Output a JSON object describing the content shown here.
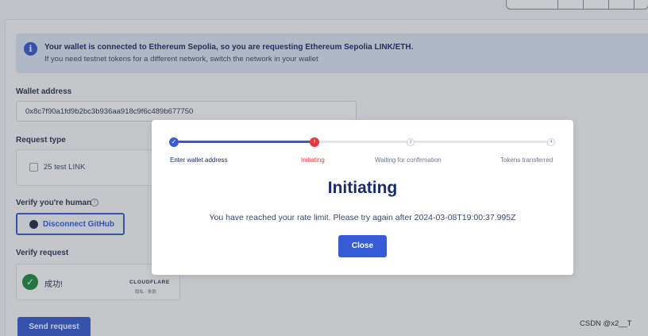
{
  "banner": {
    "title": "Your wallet is connected to Ethereum Sepolia, so you are requesting Ethereum Sepolia LINK/ETH.",
    "subtitle": "If you need testnet tokens for a different network, switch the network in your wallet"
  },
  "form": {
    "wallet_label": "Wallet address",
    "wallet_value": "0x8c7f90a1fd9b2bc3b936aa918c9f6c489b677750",
    "request_type_label": "Request type",
    "request_option": "25 test LINK",
    "verify_human_label": "Verify you're human",
    "github_button": "Disconnect GitHub",
    "verify_request_label": "Verify request",
    "captcha_status": "成功!",
    "captcha_brand": "CLOUDFLARE",
    "captcha_links": "隐私 · 条款",
    "send_button": "Send request"
  },
  "modal": {
    "steps": [
      {
        "label": "Enter wallet address",
        "status": "done"
      },
      {
        "label": "Initiating",
        "status": "error"
      },
      {
        "label": "Waiting for confirmation",
        "status": "pending"
      },
      {
        "label": "Tokens transferred",
        "status": "pending"
      }
    ],
    "step_numbers": [
      "3",
      "4"
    ],
    "title": "Initiating",
    "message": "You have reached your rate limit. Please try again after 2024-03-08T19:00:37.995Z",
    "close_button": "Close"
  },
  "watermark": "CSDN @x2__T",
  "colors": {
    "accent": "#375bd2",
    "error": "#e23b3b",
    "success": "#1e8b3e"
  }
}
